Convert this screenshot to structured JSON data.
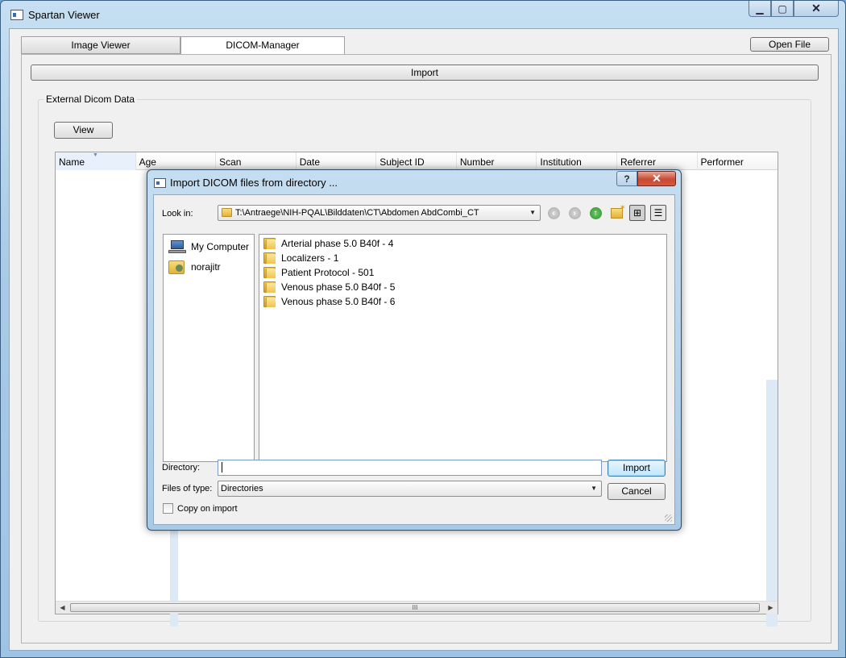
{
  "window": {
    "title": "Spartan Viewer",
    "minimize": "▁",
    "maximize": "▢",
    "close": "✕"
  },
  "tabs": [
    {
      "label": "Image Viewer",
      "active": false
    },
    {
      "label": "DICOM-Manager",
      "active": true
    }
  ],
  "toolbar": {
    "open_file_label": "Open File",
    "import_label": "Import"
  },
  "group": {
    "title": "External Dicom Data",
    "view_label": "View"
  },
  "table": {
    "columns": [
      "Name",
      "Age",
      "Scan",
      "Date",
      "Subject ID",
      "Number",
      "Institution",
      "Referrer",
      "Performer"
    ],
    "sort_indicator": "▼",
    "scroll_left": "◀",
    "scroll_right": "▶",
    "scroll_grip": "III"
  },
  "dialog": {
    "title": "Import DICOM files from directory ...",
    "help_label": "?",
    "close_label": "✕",
    "look_in_label": "Look in:",
    "look_in_path": "T:\\Antraege\\NIH-PQAL\\Bilddaten\\CT\\Abdomen AbdCombi_CT",
    "nav": {
      "back": "‹",
      "forward": "›",
      "up": "↑",
      "list_mode": "⊞",
      "detail_mode": "☰"
    },
    "sidebar": [
      "My Computer",
      "norajitr"
    ],
    "files": [
      "Arterial phase 5.0 B40f - 4",
      "Localizers - 1",
      "Patient Protocol - 501",
      "Venous phase 5.0 B40f - 5",
      "Venous phase 5.0 B40f - 6"
    ],
    "directory_label": "Directory:",
    "directory_value": "",
    "file_type_label": "Files of type:",
    "file_type_value": "Directories",
    "import_label": "Import",
    "cancel_label": "Cancel",
    "copy_label": "Copy on import",
    "copy_checked": false
  },
  "colors": {
    "title_gradient_top": "#c6dff2",
    "close_red": "#c74a33",
    "accent_blue": "#3c7fb1"
  }
}
